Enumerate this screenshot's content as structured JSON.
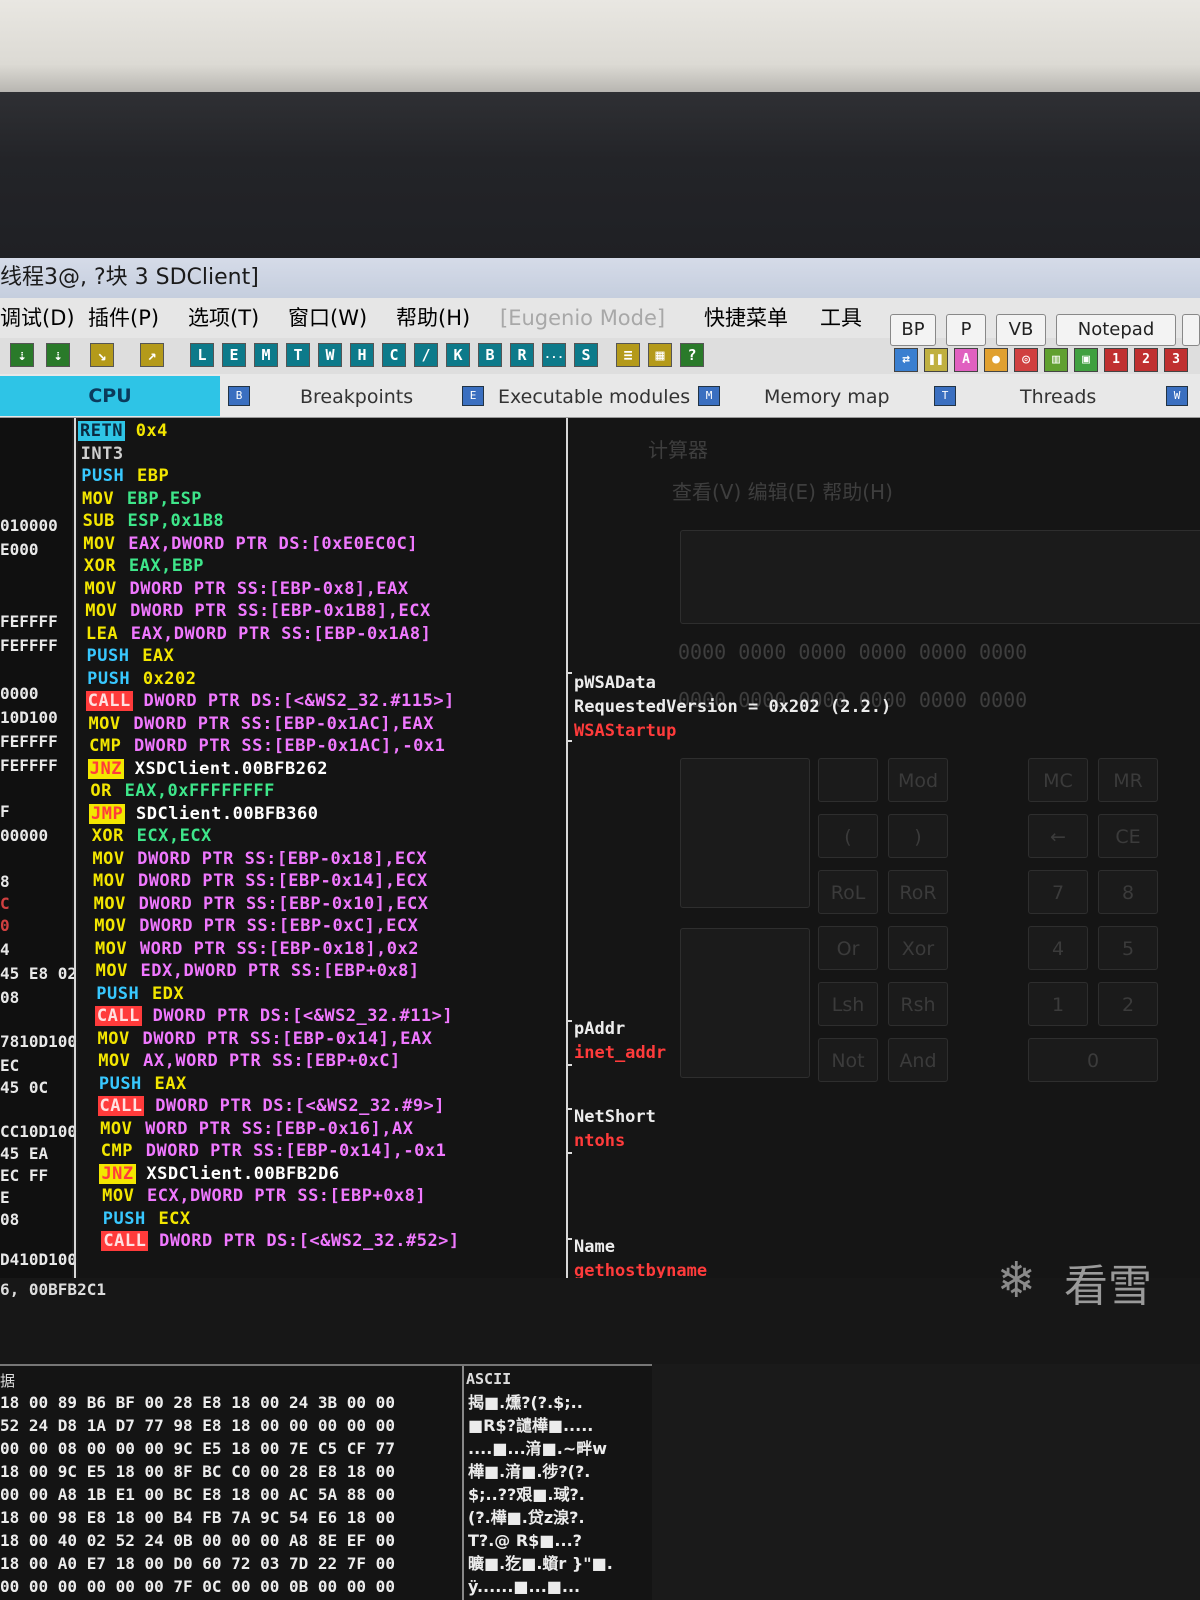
{
  "window": {
    "title": "线程3@, ?块 3 SDClient]"
  },
  "menu": {
    "items": [
      "调试(D)",
      "插件(P)",
      "选项(T)",
      "窗口(W)",
      "帮助(H)",
      "[Eugenio Mode]",
      "快捷菜单",
      "工具"
    ]
  },
  "toolbar": {
    "letters": [
      "L",
      "E",
      "M",
      "T",
      "W",
      "H",
      "C",
      "/",
      "K",
      "B",
      "R",
      "...",
      "S"
    ],
    "right_buttons": [
      "BP",
      "P",
      "VB",
      "Notepad"
    ],
    "right_icons": [
      "A",
      "1",
      "2",
      "3"
    ]
  },
  "tabs": [
    "CPU",
    "Breakpoints",
    "Executable modules",
    "Memory map",
    "Threads"
  ],
  "addresses": [
    "010000",
    "E000",
    "FEFFFF",
    "FEFFFF",
    "0000",
    "10D100",
    "FEFFFF",
    "FEFFFF",
    "F",
    "00000",
    "8",
    "C",
    "0",
    "4",
    "45 E8 02",
    "08",
    "7810D100",
    "EC",
    "45  0C",
    "CC10D100",
    "45 EA",
    "EC FF",
    "E",
    "08",
    "D410D100"
  ],
  "disasm": [
    {
      "mn": "RETN",
      "ops": "0x4"
    },
    {
      "mn": "INT3",
      "ops": ""
    },
    {
      "mn": "PUSH",
      "ops": "EBP"
    },
    {
      "mn": "MOV",
      "ops": "EBP,ESP"
    },
    {
      "mn": "SUB",
      "ops": "ESP,0x1B8"
    },
    {
      "mn": "MOV",
      "ops": "EAX,DWORD PTR DS:[0xE0EC0C]"
    },
    {
      "mn": "XOR",
      "ops": "EAX,EBP"
    },
    {
      "mn": "MOV",
      "ops": "DWORD PTR SS:[EBP-0x8],EAX"
    },
    {
      "mn": "MOV",
      "ops": "DWORD PTR SS:[EBP-0x1B8],ECX"
    },
    {
      "mn": "LEA",
      "ops": "EAX,DWORD PTR SS:[EBP-0x1A8]"
    },
    {
      "mn": "PUSH",
      "ops": "EAX"
    },
    {
      "mn": "PUSH",
      "ops": "0x202"
    },
    {
      "mn": "CALL",
      "ops": "DWORD PTR DS:[<&WS2_32.#115>]"
    },
    {
      "mn": "MOV",
      "ops": "DWORD PTR SS:[EBP-0x1AC],EAX"
    },
    {
      "mn": "CMP",
      "ops": "DWORD PTR SS:[EBP-0x1AC],-0x1"
    },
    {
      "mn": "JNZ",
      "ops": "XSDClient.00BFB262"
    },
    {
      "mn": "OR",
      "ops": "EAX,0xFFFFFFFF"
    },
    {
      "mn": "JMP",
      "ops": "SDClient.00BFB360"
    },
    {
      "mn": "XOR",
      "ops": "ECX,ECX"
    },
    {
      "mn": "MOV",
      "ops": "DWORD PTR SS:[EBP-0x18],ECX"
    },
    {
      "mn": "MOV",
      "ops": "DWORD PTR SS:[EBP-0x14],ECX"
    },
    {
      "mn": "MOV",
      "ops": "DWORD PTR SS:[EBP-0x10],ECX"
    },
    {
      "mn": "MOV",
      "ops": "DWORD PTR SS:[EBP-0xC],ECX"
    },
    {
      "mn": "MOV",
      "ops": "WORD PTR SS:[EBP-0x18],0x2"
    },
    {
      "mn": "MOV",
      "ops": "EDX,DWORD PTR SS:[EBP+0x8]"
    },
    {
      "mn": "PUSH",
      "ops": "EDX"
    },
    {
      "mn": "CALL",
      "ops": "DWORD PTR DS:[<&WS2_32.#11>]"
    },
    {
      "mn": "MOV",
      "ops": "DWORD PTR SS:[EBP-0x14],EAX"
    },
    {
      "mn": "MOV",
      "ops": "AX,WORD PTR SS:[EBP+0xC]"
    },
    {
      "mn": "PUSH",
      "ops": "EAX"
    },
    {
      "mn": "CALL",
      "ops": "DWORD PTR DS:[<&WS2_32.#9>]"
    },
    {
      "mn": "MOV",
      "ops": "WORD PTR SS:[EBP-0x16],AX"
    },
    {
      "mn": "CMP",
      "ops": "DWORD PTR SS:[EBP-0x14],-0x1"
    },
    {
      "mn": "JNZ",
      "ops": "XSDClient.00BFB2D6"
    },
    {
      "mn": "MOV",
      "ops": "ECX,DWORD PTR SS:[EBP+0x8]"
    },
    {
      "mn": "PUSH",
      "ops": "ECX"
    },
    {
      "mn": "CALL",
      "ops": "DWORD PTR DS:[<&WS2_32.#52>]"
    }
  ],
  "annotations": {
    "wsa_arg": "pWSAData",
    "wsa_version": "RequestedVersion = 0x202 (2.2.)",
    "wsa_func": "WSAStartup",
    "addr_arg": "pAddr",
    "addr_func": "inet_addr",
    "short_arg": "NetShort",
    "short_func": "ntohs",
    "name_arg": "Name",
    "name_func": "gethostbyname"
  },
  "status": {
    "line1": "6, 00BFB2C1"
  },
  "dump": {
    "label": "据",
    "ascii_header": "ASCII",
    "rows": [
      {
        "hex": "18 00 89 B6 BF 00 28 E8 18 00 24 3B 00 00",
        "ascii": "揭■.燻?(?.$;.."
      },
      {
        "hex": "52 24 D8 1A D7 77 98 E8 18 00 00 00 00 00",
        "ascii": "■R$?譴樺■....."
      },
      {
        "hex": "00 00 08 00 00 00 9C E5 18 00 7E C5 CF 77",
        "ascii": "....■...湇■.~畔w"
      },
      {
        "hex": "18 00 9C E5 18 00 8F BC C0 00 28 E8 18 00",
        "ascii": "樺■.湇■.徏?(?."
      },
      {
        "hex": "00 00 A8 1B E1 00 BC E8 18 00 AC 5A 88 00",
        "ascii": "$;..??艰■.琙?."
      },
      {
        "hex": "18 00 98 E8 18 00 B4 FB 7A 9C 54 E6 18 00",
        "ascii": "(?.樺■.贷z湶?."
      },
      {
        "hex": "18 00 40 02 52 24 0B 00 00 00 A8 8E EF 00",
        "ascii": "T?.@ R$■...?"
      },
      {
        "hex": "18 00 A0 E7 18 00 D0 60 72 03 7D 22 7F 00",
        "ascii": "曠■.犵■.蠀r }\"■."
      },
      {
        "hex": "00 00 00 00 00 00 7F 0C 00 00 0B 00 00 00",
        "ascii": "ÿ......■...■..."
      }
    ]
  },
  "background_calc": {
    "title": "计算器",
    "menu": "查看(V)  编辑(E)  帮助(H)",
    "watermark": "看雪"
  },
  "colors": {
    "accent_cyan": "#2ec4e6",
    "yellow": "#f3e600",
    "magenta": "#f078ff",
    "red": "#ff3b3b",
    "white": "#e8e8e8"
  }
}
